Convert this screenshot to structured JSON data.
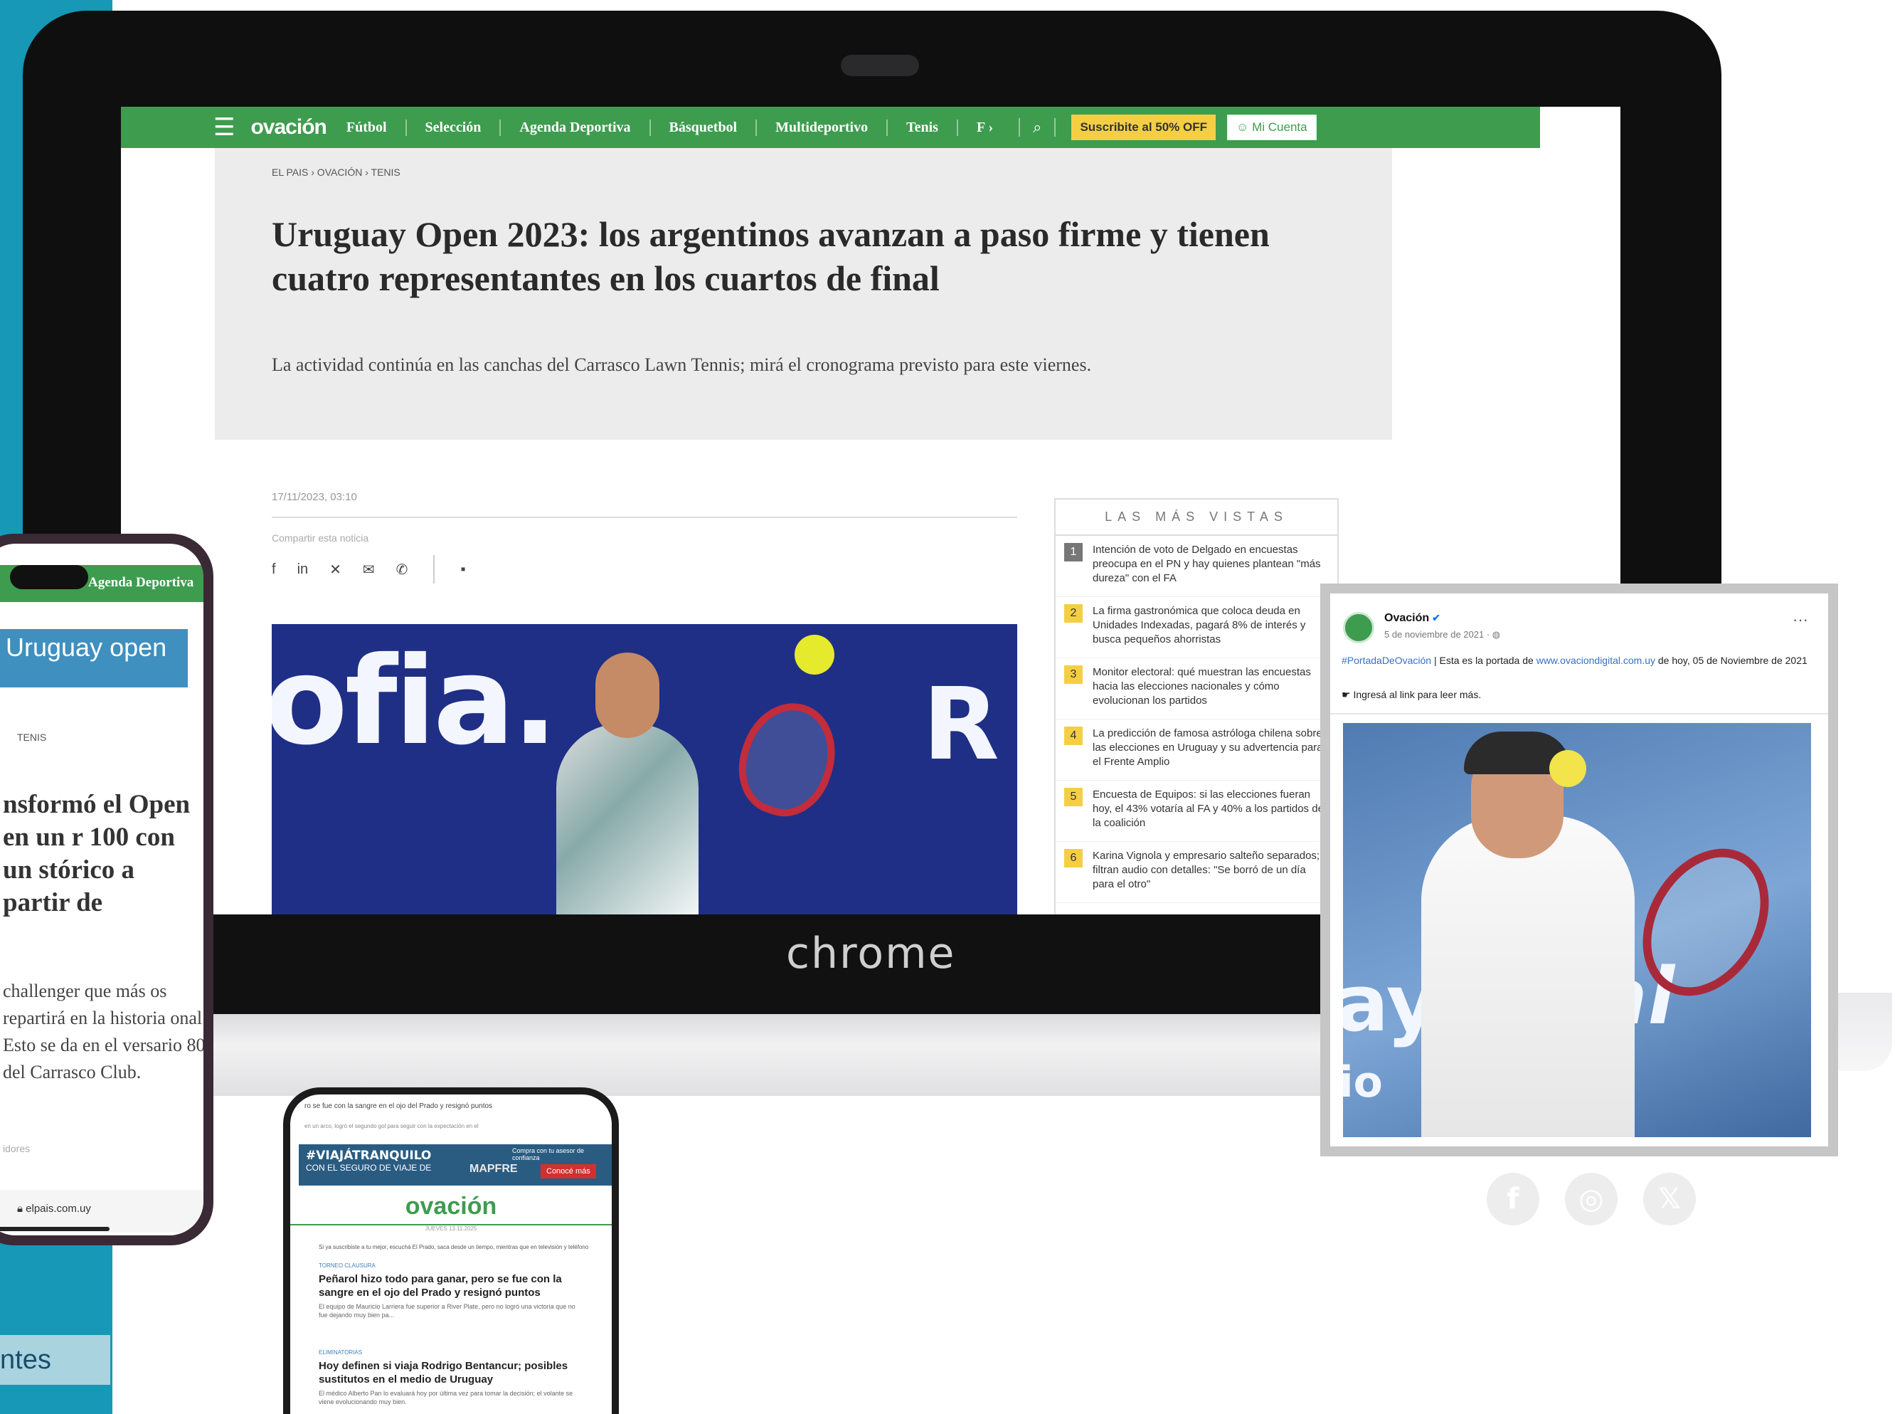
{
  "desktop": {
    "nav": {
      "menu_icon": "hamburger-icon",
      "logo": "ovación",
      "items": [
        "Fútbol",
        "Selección",
        "Agenda Deportiva",
        "Básquetbol",
        "Multideportivo",
        "Tenis",
        "F"
      ],
      "more_icon": "chevron-right-icon",
      "search_icon": "search-icon",
      "subscribe": "Suscribite al 50% OFF",
      "account": "Mi Cuenta",
      "accent": "#3e9c4f",
      "subscribe_color": "#f4cf43"
    },
    "breadcrumb": "EL PAIS  ›  OVACIÓN  ›  TENIS",
    "headline": "Uruguay Open 2023: los argentinos avanzan a paso firme y tienen cuatro representantes en los cuartos de final",
    "subheadline": "La actividad continúa en las canchas del Carrasco Lawn Tennis; mirá el cronograma previsto para este viernes.",
    "date": "17/11/2023, 03:10",
    "share_label": "Compartir esta noticia",
    "share_icons": [
      "facebook-icon",
      "linkedin-icon",
      "x-icon",
      "email-icon",
      "whatsapp-icon",
      "comment-icon"
    ],
    "photo_text_left": "ofia.",
    "photo_text_right": "R",
    "most_viewed": {
      "title": "LAS MÁS VISTAS",
      "items": [
        {
          "num": "1",
          "text": "Intención de voto de Delgado en encuestas preocupa en el PN y hay quienes plantean \"más dureza\" con el FA"
        },
        {
          "num": "2",
          "text": "La firma gastronómica que coloca deuda en Unidades Indexadas, pagará 8% de interés y busca pequeños ahorristas"
        },
        {
          "num": "3",
          "text": "Monitor electoral: qué muestran las encuestas hacia las elecciones nacionales y cómo evolucionan los partidos"
        },
        {
          "num": "4",
          "text": "La predicción de famosa astróloga chilena sobre las elecciones en Uruguay y su advertencia para el Frente Amplio"
        },
        {
          "num": "5",
          "text": "Encuesta de Equipos: si las elecciones fueran hoy, el 43% votaría al FA y 40% a los partidos de la coalición"
        },
        {
          "num": "6",
          "text": "Karina Vignola y empresario salteño separados; filtran audio con detalles: \"Se borró de un día para el otro\""
        }
      ]
    },
    "laptop_brand": "chrome"
  },
  "phone_left": {
    "nav_label": "Agenda Deportiva",
    "banner": "Uruguay open",
    "crumb": "TENIS",
    "headline": "nsformó el Open en un r 100 con un stórico a partir de",
    "body": "challenger que más os repartirá en la historia onal. Esto se da en el versario 80 del Carrasco Club.",
    "sub": "idores",
    "url": "elpais.com.uy"
  },
  "phone_bottom": {
    "top_text": "ro se fue con la sangre en el ojo del Prado y resignó puntos",
    "top_small": "en un arco, logró el segundo gol para seguir con la expectación en el",
    "ad_title": "#VIAJÁTRANQUILO",
    "ad_sub": "CON EL SEGURO DE VIAJE DE",
    "ad_brand": "MAPFRE",
    "ad_small": "Compra con tu asesor de confianza",
    "ad_cta": "Conocé más",
    "logo": "ovación",
    "logo_date": "JUEVES 13.11.2025",
    "small_line": "Si ya suscribiste a tu mejor, escuchá El Prado, saca desde un tiempo, mientras que en televisión y teléfono",
    "articles": [
      {
        "section": "TORNEO CLAUSURA",
        "title": "Peñarol hizo todo para ganar, pero se fue con la sangre en el ojo del Prado y resignó puntos",
        "desc": "El equipo de Mauricio Larriera fue superior a River Plate, pero no logró una victoria que no fue dejando muy bien pa..."
      },
      {
        "section": "ELIMINATORIAS",
        "title": "Hoy definen si viaja Rodrigo Bentancur; posibles sustitutos en el medio de Uruguay",
        "desc": "El médico Alberto Pan lo evaluará hoy por última vez para tomar la decisión; el volante se viene evolucionando muy bien."
      }
    ]
  },
  "facebook_post": {
    "page_name": "Ovación",
    "verified_icon": "verified-icon",
    "date": "5 de noviembre de 2021 · ",
    "globe_icon": "globe-icon",
    "hashtag": "#PortadaDeOvación",
    "text_mid": " | Esta es la portada de ",
    "link": "www.ovaciondigital.com.uy",
    "text_end": " de hoy, 05 de Noviembre de 2021",
    "more": "Ingresá al link para leer más.",
    "photo_text_1": "ay",
    "photo_text_2": "ral",
    "photo_text_3": "io"
  },
  "social": [
    {
      "icon": "facebook-icon",
      "glyph": "f"
    },
    {
      "icon": "instagram-icon",
      "glyph": "◎"
    },
    {
      "icon": "x-icon",
      "glyph": "𝕏"
    }
  ],
  "teal_label": "ntes"
}
